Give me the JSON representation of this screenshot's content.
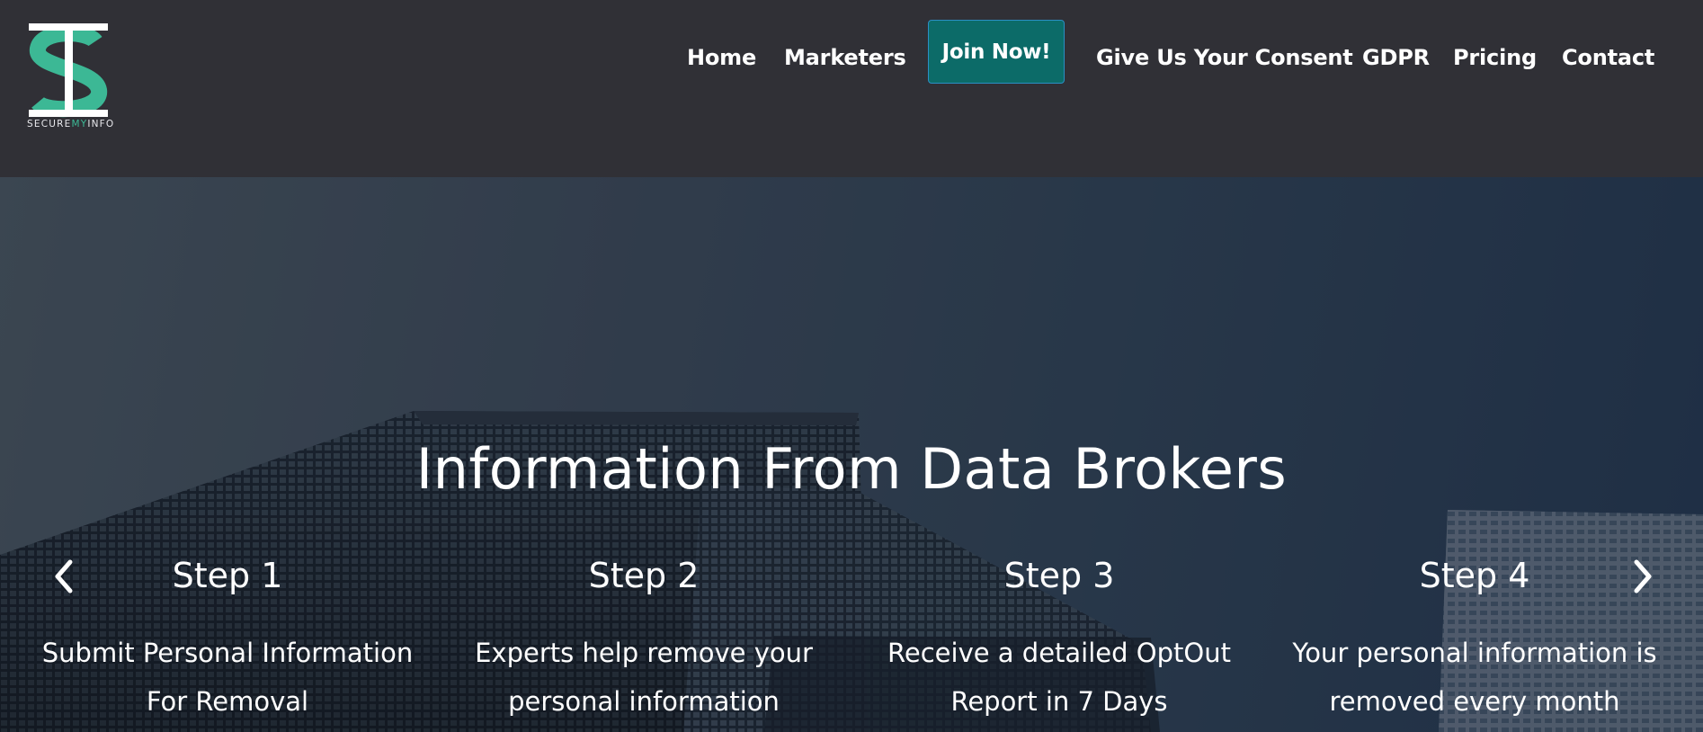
{
  "logo": {
    "wordmark_part1": "SECURE",
    "wordmark_part2": "MY",
    "wordmark_part3": "INFO",
    "accent_color": "#3cb895"
  },
  "nav": {
    "home": "Home",
    "marketers": "Marketers",
    "join": "Join Now!",
    "consent": "Give Us Your Consent",
    "gdpr": "GDPR",
    "pricing": "Pricing",
    "contact": "Contact",
    "join_color": "#0c6b68"
  },
  "hero": {
    "title": "Information From Data Brokers",
    "steps": [
      {
        "title": "Step 1",
        "desc_line1": "Submit Personal Information",
        "desc_line2": "For Removal"
      },
      {
        "title": "Step 2",
        "desc_line1": "Experts help remove your",
        "desc_line2": "personal information"
      },
      {
        "title": "Step 3",
        "desc_line1": "Receive a detailed OptOut",
        "desc_line2": "Report in 7 Days"
      },
      {
        "title": "Step 4",
        "desc_line1": "Your personal information is",
        "desc_line2": "removed every month"
      }
    ],
    "prev_icon": "chevron-left-icon",
    "next_icon": "chevron-right-icon"
  }
}
